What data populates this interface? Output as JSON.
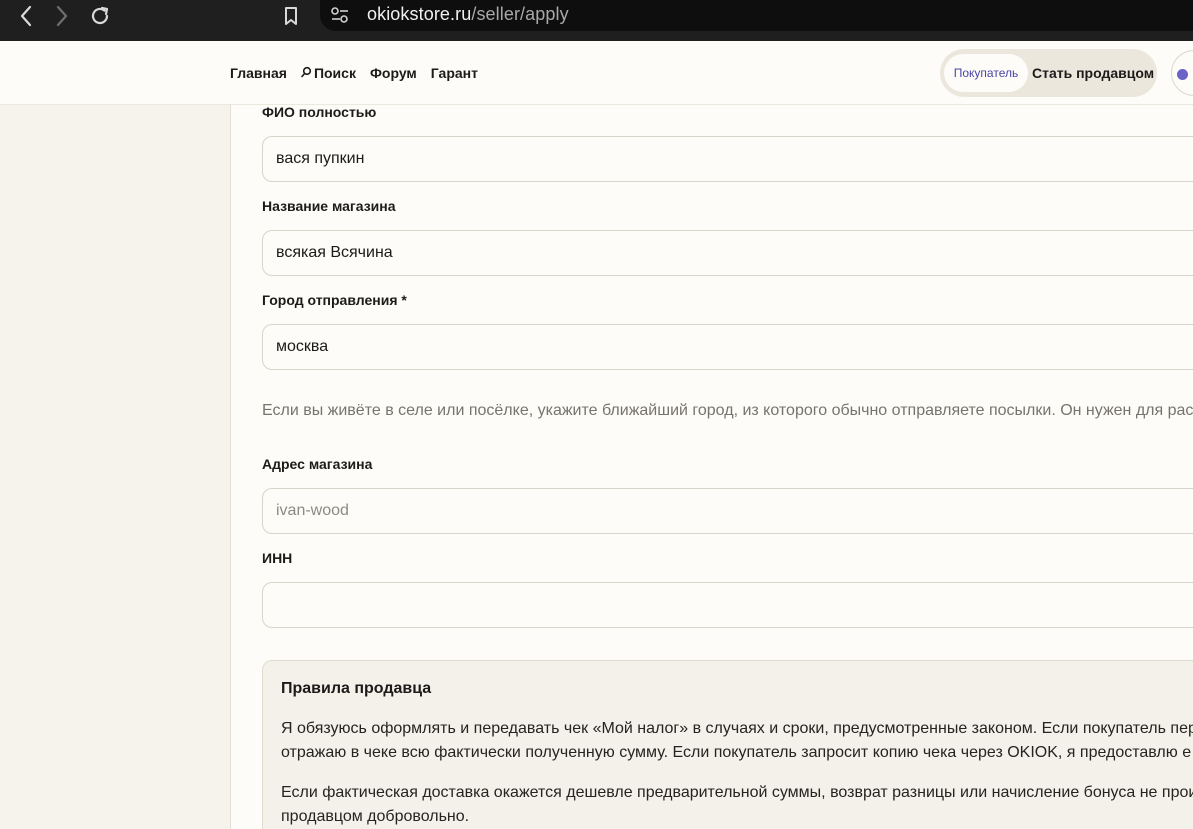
{
  "browser": {
    "url_host": "okiokstore.ru",
    "url_path": "/seller/apply"
  },
  "header": {
    "nav": [
      {
        "label": "Главная"
      },
      {
        "label": "Поиск",
        "icon": "search-icon"
      },
      {
        "label": "Форум"
      },
      {
        "label": "Гарант"
      }
    ],
    "role_buyer": "Покупатель",
    "role_seller": "Стать продавцом"
  },
  "form": {
    "full_name": {
      "label": "ФИО полностью",
      "value": "вася пупкин"
    },
    "shop_name": {
      "label": "Название магазина",
      "value": "всякая Всячина"
    },
    "city": {
      "label": "Город отправления *",
      "value": "москва"
    },
    "city_hint": "Если вы живёте в селе или посёлке, укажите ближайший город, из которого обычно отправляете посылки. Он нужен для рас",
    "shop_address": {
      "label": "Адрес магазина",
      "placeholder": "ivan-wood"
    },
    "inn": {
      "label": "ИНН",
      "value": ""
    }
  },
  "rules": {
    "title": "Правила продавца",
    "p1_line1": "Я обязуюсь оформлять и передавать чек «Мой налог» в случаях и сроки, предусмотренные законом. Если покупатель пер",
    "p1_line2": "отражаю в чеке всю фактически полученную сумму. Если покупатель запросит копию чека через OKIOK, я предоставлю е",
    "p2_line1": "Если фактическая доставка окажется дешевле предварительной суммы, возврат разницы или начисление бонуса не прои",
    "p2_line2": "продавцом добровольно."
  },
  "colors": {
    "accent": "#4a45a8",
    "page_bg": "#f5f3ec",
    "panel_bg": "#fdfcf8"
  }
}
